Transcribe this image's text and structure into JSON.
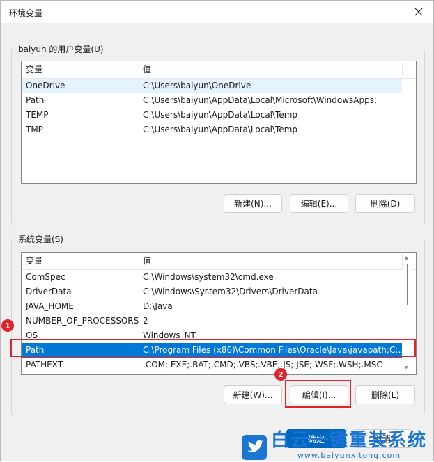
{
  "window": {
    "title": "环境变量",
    "close_icon": "close-icon"
  },
  "user_section": {
    "legend": "baiyun 的用户变量(U)",
    "columns": [
      "变量",
      "值"
    ],
    "rows": [
      {
        "name": "OneDrive",
        "value": "C:\\Users\\baiyun\\OneDrive"
      },
      {
        "name": "Path",
        "value": "C:\\Users\\baiyun\\AppData\\Local\\Microsoft\\WindowsApps;"
      },
      {
        "name": "TEMP",
        "value": "C:\\Users\\baiyun\\AppData\\Local\\Temp"
      },
      {
        "name": "TMP",
        "value": "C:\\Users\\baiyun\\AppData\\Local\\Temp"
      }
    ],
    "buttons": {
      "new": "新建(N)...",
      "edit": "编辑(E)...",
      "delete": "删除(D)"
    }
  },
  "system_section": {
    "legend": "系统变量(S)",
    "columns": [
      "变量",
      "值"
    ],
    "rows": [
      {
        "name": "ComSpec",
        "value": "C:\\Windows\\system32\\cmd.exe"
      },
      {
        "name": "DriverData",
        "value": "C:\\Windows\\System32\\Drivers\\DriverData"
      },
      {
        "name": "JAVA_HOME",
        "value": "D:\\Java"
      },
      {
        "name": "NUMBER_OF_PROCESSORS",
        "value": "2"
      },
      {
        "name": "OS",
        "value": "Windows_NT"
      },
      {
        "name": "Path",
        "value": "C:\\Program Files (x86)\\Common Files\\Oracle\\Java\\javapath;C:..."
      },
      {
        "name": "PATHEXT",
        "value": ".COM;.EXE;.BAT;.CMD;.VBS;.VBE;.JS;.JSE;.WSF;.WSH;.MSC"
      }
    ],
    "selected_row": "Path",
    "buttons": {
      "new": "新建(W)...",
      "edit": "编辑(I)...",
      "delete": "删除(L)"
    }
  },
  "footer": {
    "ok": "确定",
    "cancel": "取消"
  },
  "annotations": {
    "badge1": "1",
    "badge2": "2",
    "color": "#e0242a"
  },
  "watermark": {
    "text": "白云一键重装系统",
    "url": "www.baiyunxitong.com"
  },
  "colors": {
    "selection": "#0078d7",
    "hover": "#e5f3ff",
    "accent": "#0067c0"
  }
}
